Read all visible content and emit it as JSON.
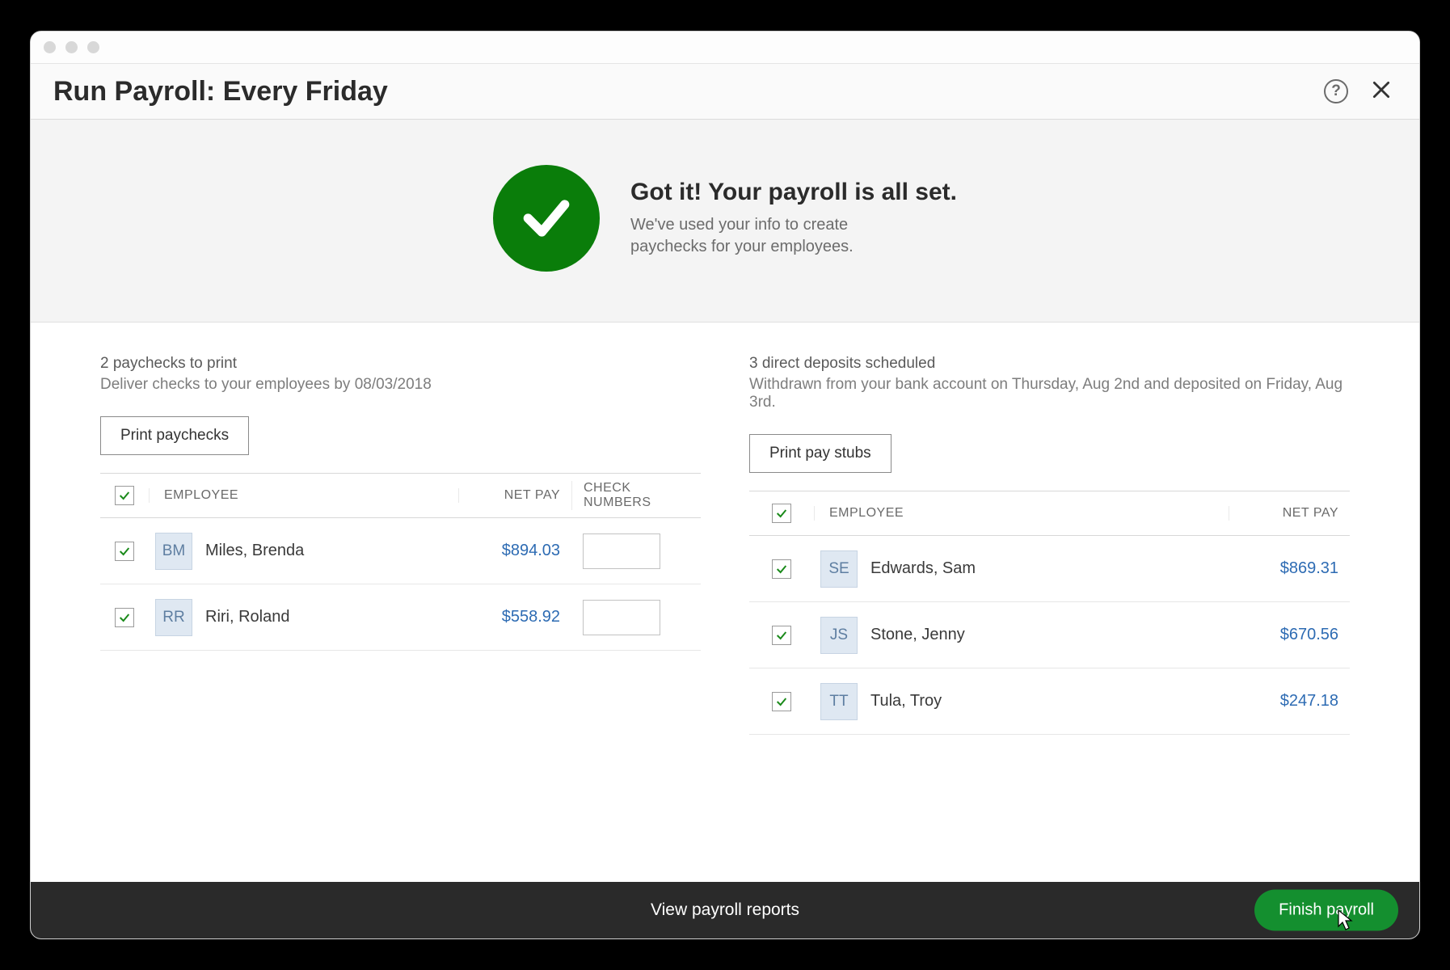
{
  "header": {
    "title": "Run Payroll: Every Friday"
  },
  "banner": {
    "headline": "Got it! Your payroll is all set.",
    "sub1": "We've used your info to create",
    "sub2": "paychecks for your employees."
  },
  "paychecks": {
    "line1": "2 paychecks to print",
    "line2": "Deliver checks to your employees by 08/03/2018",
    "button": "Print paychecks",
    "columns": {
      "employee": "EMPLOYEE",
      "net": "NET PAY",
      "check": "CHECK NUMBERS"
    },
    "rows": [
      {
        "initials": "BM",
        "name": "Miles, Brenda",
        "net": "$894.03",
        "check": ""
      },
      {
        "initials": "RR",
        "name": "Riri, Roland",
        "net": "$558.92",
        "check": ""
      }
    ]
  },
  "deposits": {
    "line1": "3 direct deposits scheduled",
    "line2": "Withdrawn from your bank account on Thursday, Aug 2nd and deposited on Friday, Aug 3rd.",
    "button": "Print pay stubs",
    "columns": {
      "employee": "EMPLOYEE",
      "net": "NET PAY"
    },
    "rows": [
      {
        "initials": "SE",
        "name": "Edwards, Sam",
        "net": "$869.31"
      },
      {
        "initials": "JS",
        "name": "Stone, Jenny",
        "net": "$670.56"
      },
      {
        "initials": "TT",
        "name": "Tula, Troy",
        "net": "$247.18"
      }
    ]
  },
  "footer": {
    "link": "View payroll reports",
    "finish": "Finish payroll"
  },
  "colors": {
    "success": "#0a7d0a",
    "primary": "#148f2f",
    "link": "#2d6bb3"
  }
}
